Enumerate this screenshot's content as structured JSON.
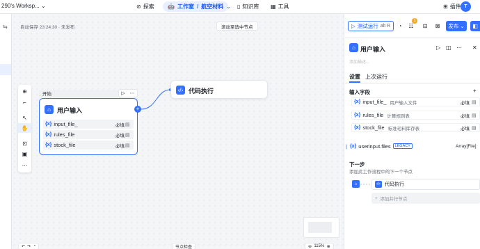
{
  "topbar": {
    "workspace_title": "290's Worksp...",
    "workspace_caret": "⌄",
    "nav": {
      "explore": "探索",
      "studio": "工作室",
      "project": "航空材料",
      "knowledge": "知识库",
      "tools": "工具",
      "plugins": "插件"
    },
    "avatar_letter": "T"
  },
  "canvas": {
    "autosave_text": "自动保存 23:24:30 · 未发布",
    "scroll_button": "滚动至选中节点",
    "start_label": "开始",
    "start_node": {
      "title": "用户输入",
      "fields": [
        {
          "name": "input_file_",
          "required": "必填"
        },
        {
          "name": "rules_file",
          "required": "必填"
        },
        {
          "name": "stock_file",
          "required": "必填"
        }
      ]
    },
    "code_node": {
      "title": "代码执行"
    },
    "bottom": {
      "check_label": "节点检查",
      "zoom": "115%"
    }
  },
  "panel": {
    "run_button": "测试运行",
    "run_shortcut": "alt R",
    "issue_count": "1",
    "publish_button": "发布",
    "title": "用户输入",
    "description_placeholder": "添加描述...",
    "tabs": [
      "设置",
      "上次运行"
    ],
    "input_section_title": "输入字段",
    "inputs": [
      {
        "name": "input_file_",
        "desc": "用户输入文件",
        "required": "必填"
      },
      {
        "name": "rules_file",
        "desc": "计算规则表",
        "required": "必填"
      },
      {
        "name": "stock_file",
        "desc": "标准毛料库存表",
        "required": "必填"
      }
    ],
    "legacy": {
      "name": "userinput.files",
      "tag": "LEGACY",
      "type": "Array[File]"
    },
    "next_section_title": "下一步",
    "next_section_sub": "添加此工作流程中的下一个节点",
    "next_node": "代码执行",
    "add_parallel": "添加并行节点"
  },
  "colors": {
    "accent": "#3370ff",
    "accent_text": "#1456f0",
    "badge": "#f5a623"
  }
}
